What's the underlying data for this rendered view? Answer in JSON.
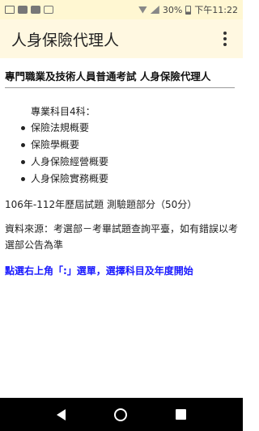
{
  "status_bar": {
    "battery": "30%",
    "time": "下午11:22",
    "icons": [
      "mail-icon",
      "image-icon",
      "photo-icon",
      "pulse-icon",
      "wifi-icon",
      "signal-icon",
      "battery-icon"
    ]
  },
  "app_bar": {
    "title": "人身保險代理人",
    "menu_icon": "overflow-menu-icon"
  },
  "content": {
    "exam_title": "專門職業及技術人員普通考試 人身保險代理人",
    "subjects_header": "專業科目4科：",
    "subjects": [
      "保險法規概要",
      "保險學概要",
      "人身保險經營概要",
      "人身保險實務概要"
    ],
    "exam_range": "106年-112年歷屆試題 測驗題部分（50分）",
    "source": "資料來源：考選部－考畢試題查詢平臺，如有錯誤以考選部公告為準",
    "hint": "點選右上角「:」選單，選擇科目及年度開始"
  },
  "colors": {
    "status_bar_bg": "#fff7d2",
    "app_bar_bg": "#fff8e1",
    "hint_text": "#1a1aff",
    "nav_bar_bg": "#000000"
  },
  "nav_bar": {
    "icons": [
      "back-icon",
      "home-icon",
      "recents-icon"
    ]
  }
}
